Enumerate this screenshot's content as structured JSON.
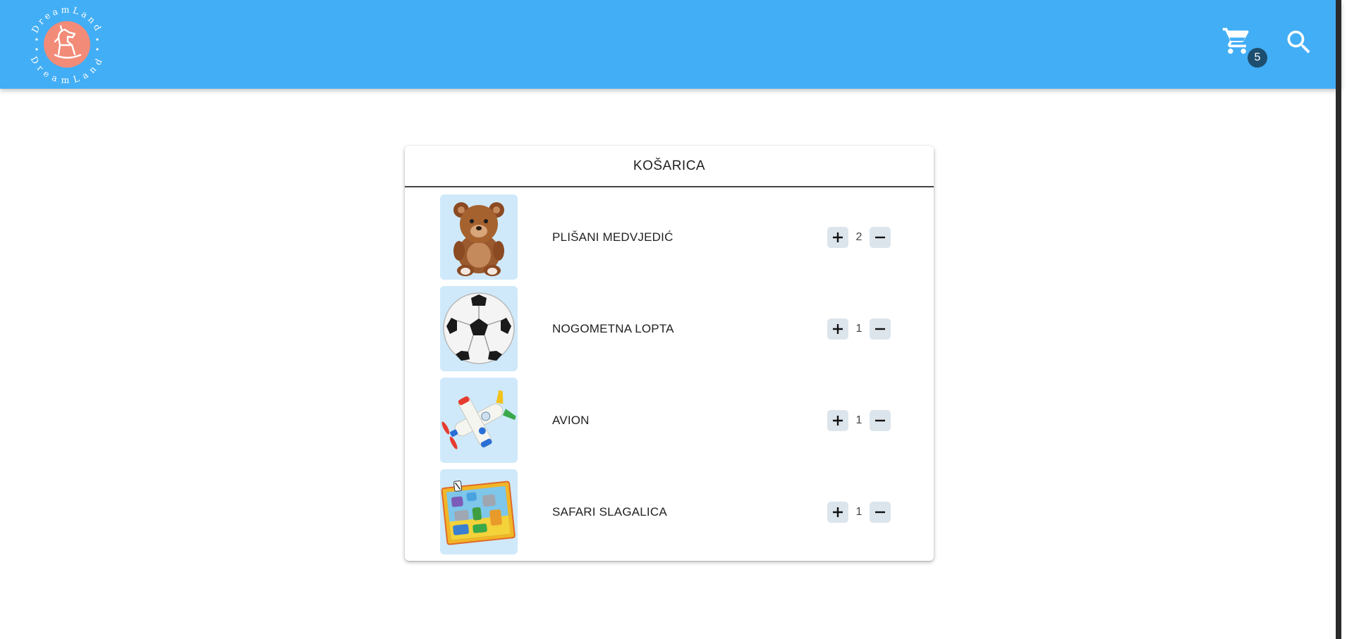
{
  "logo": {
    "text": "DreamLand",
    "icon": "rocking-horse-icon",
    "badge_color": "#f28b78"
  },
  "header": {
    "cart_count": "5",
    "cart_icon": "shopping-cart-icon",
    "search_icon": "search-icon",
    "bg_color": "#42aef5"
  },
  "cart": {
    "title": "KOŠARICA",
    "items": [
      {
        "name": "PLIŠANI MEDVJEDIĆ",
        "qty": "2",
        "image": "teddy-bear-image"
      },
      {
        "name": "NOGOMETNA LOPTA",
        "qty": "1",
        "image": "soccer-ball-image"
      },
      {
        "name": "AVION",
        "qty": "1",
        "image": "toy-airplane-image"
      },
      {
        "name": "SAFARI SLAGALICA",
        "qty": "1",
        "image": "safari-puzzle-image"
      }
    ]
  }
}
